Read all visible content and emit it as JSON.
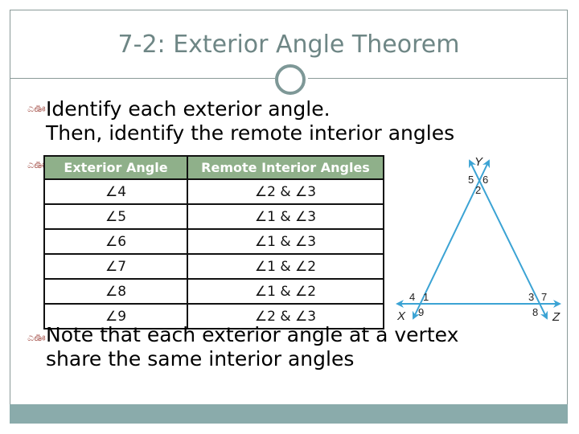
{
  "slide": {
    "title": "7-2: Exterior Angle Theorem",
    "bullets": [
      {
        "line1": "Identify each exterior angle.",
        "line2": "Then, identify the remote interior angles"
      },
      {
        "line1": "Note that each exterior angle at a vertex",
        "line2": "share the same interior angles"
      }
    ],
    "bullet_glyph": "ಎఊ",
    "table": {
      "headers": [
        "Exterior Angle",
        "Remote Interior Angles"
      ],
      "rows": [
        [
          "∠4",
          "∠2 & ∠3"
        ],
        [
          "∠5",
          "∠1 & ∠3"
        ],
        [
          "∠6",
          "∠1 & ∠3"
        ],
        [
          "∠7",
          "∠1 & ∠2"
        ],
        [
          "∠8",
          "∠1 & ∠2"
        ],
        [
          "∠9",
          "∠2 & ∠3"
        ]
      ]
    },
    "diagram": {
      "vertices": {
        "top": "Y",
        "left": "X",
        "right": "Z"
      },
      "angle_labels": {
        "at_Y": [
          "5",
          "6",
          "2"
        ],
        "at_X": [
          "4",
          "1",
          "9"
        ],
        "at_Z": [
          "3",
          "7",
          "8"
        ]
      },
      "line_color": "#3ba3d4"
    },
    "colors": {
      "title": "#6e8685",
      "header_bg": "#8fb08a",
      "bottom_bar": "#8aabab",
      "bullet": "#b5706a"
    }
  }
}
